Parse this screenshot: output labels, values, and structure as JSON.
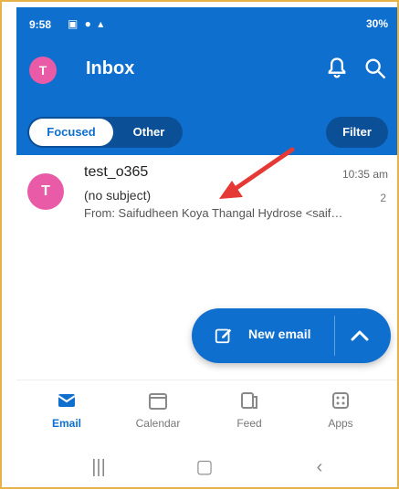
{
  "status": {
    "time": "9:58",
    "right": "30%"
  },
  "header": {
    "avatar": "T",
    "title": "Inbox"
  },
  "tabs": {
    "focused": "Focused",
    "other": "Other",
    "filter": "Filter"
  },
  "email": {
    "avatar": "T",
    "sender": "test_o365",
    "time": "10:35 am",
    "subject": "(no subject)",
    "count": "2",
    "preview": "From: Saifudheen Koya Thangal Hydrose <saif…"
  },
  "fab": {
    "label": "New email"
  },
  "nav": {
    "email": "Email",
    "calendar": "Calendar",
    "feed": "Feed",
    "apps": "Apps"
  },
  "colors": {
    "primary": "#0f6fcf",
    "avatar": "#e95aa7",
    "arrow": "#e53935"
  },
  "icons": {
    "bell": "bell-icon",
    "search": "search-icon",
    "compose": "compose-icon",
    "chevron": "chevron-up-icon"
  }
}
